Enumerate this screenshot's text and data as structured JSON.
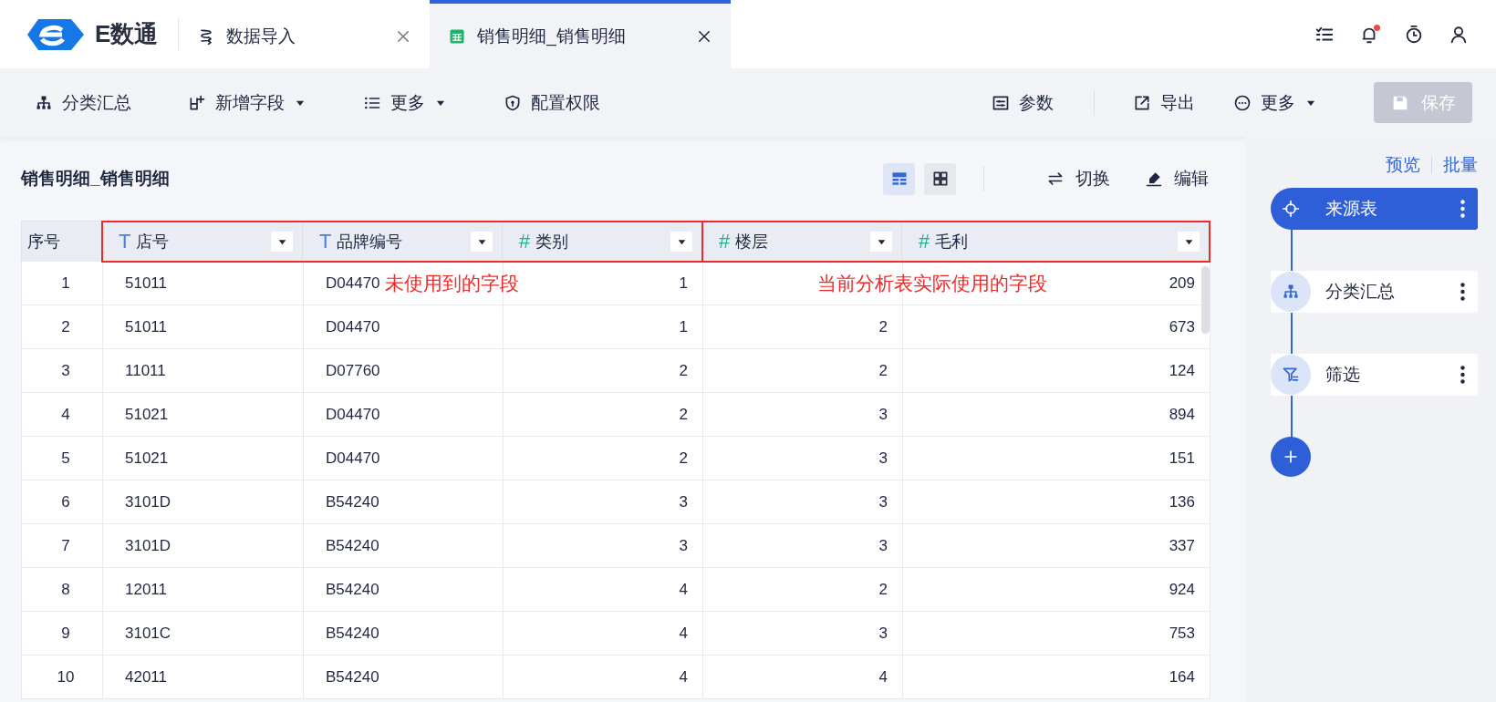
{
  "app": {
    "logo_text": "E数通"
  },
  "tabs": [
    {
      "label": "数据导入",
      "kind": "import",
      "selected": false
    },
    {
      "label": "销售明细_销售明细",
      "kind": "sheet",
      "selected": true
    }
  ],
  "notifications": {
    "unread": true
  },
  "toolbar": {
    "left": [
      {
        "label": "分类汇总",
        "kind": "summary",
        "dropdown": false
      },
      {
        "label": "新增字段",
        "kind": "add-field",
        "dropdown": true
      },
      {
        "label": "更多",
        "kind": "list",
        "dropdown": true
      },
      {
        "label": "配置权限",
        "kind": "shield",
        "dropdown": false
      }
    ],
    "right": [
      {
        "label": "参数",
        "kind": "params",
        "dropdown": false
      },
      {
        "label": "导出",
        "kind": "export",
        "dropdown": false
      },
      {
        "label": "更多",
        "kind": "more",
        "dropdown": true
      }
    ],
    "save": {
      "label": "保存",
      "disabled": true
    }
  },
  "content_title": "销售明细_销售明细",
  "view_modes": [
    {
      "kind": "table",
      "selected": true
    },
    {
      "kind": "grid",
      "selected": false
    }
  ],
  "actions": [
    {
      "label": "切换",
      "kind": "swap"
    },
    {
      "label": "编辑",
      "kind": "edit"
    }
  ],
  "table": {
    "index_column": "序号",
    "column_groups": [
      {
        "note": "未使用到的字段",
        "columns": [
          {
            "label": "店号",
            "type_mark": "T",
            "kind": "text"
          },
          {
            "label": "品牌编号",
            "type_mark": "T",
            "kind": "text"
          },
          {
            "label": "类别",
            "type_mark": "#",
            "kind": "number"
          }
        ]
      },
      {
        "note": "当前分析表实际使用的字段",
        "columns": [
          {
            "label": "楼层",
            "type_mark": "#",
            "kind": "number"
          },
          {
            "label": "毛利",
            "type_mark": "#",
            "kind": "number"
          }
        ]
      }
    ],
    "rows": [
      [
        "1",
        "51011",
        "D04470",
        "1",
        null,
        "209"
      ],
      [
        "2",
        "51011",
        "D04470",
        "1",
        "2",
        "673"
      ],
      [
        "3",
        "11011",
        "D07760",
        "2",
        "2",
        "124"
      ],
      [
        "4",
        "51021",
        "D04470",
        "2",
        "3",
        "894"
      ],
      [
        "5",
        "51021",
        "D04470",
        "2",
        "3",
        "151"
      ],
      [
        "6",
        "3101D",
        "B54240",
        "3",
        "3",
        "136"
      ],
      [
        "7",
        "3101D",
        "B54240",
        "3",
        "3",
        "337"
      ],
      [
        "8",
        "12011",
        "B54240",
        "4",
        "2",
        "924"
      ],
      [
        "9",
        "3101C",
        "B54240",
        "4",
        "3",
        "753"
      ],
      [
        "10",
        "42011",
        "B54240",
        "4",
        "4",
        "164"
      ]
    ]
  },
  "side_links": [
    "预览",
    "批量"
  ],
  "flow_steps": [
    {
      "label": "来源表",
      "kind": "source",
      "selected": true
    },
    {
      "label": "分类汇总",
      "kind": "summary",
      "selected": false
    },
    {
      "label": "筛选",
      "kind": "filter",
      "selected": false
    }
  ]
}
